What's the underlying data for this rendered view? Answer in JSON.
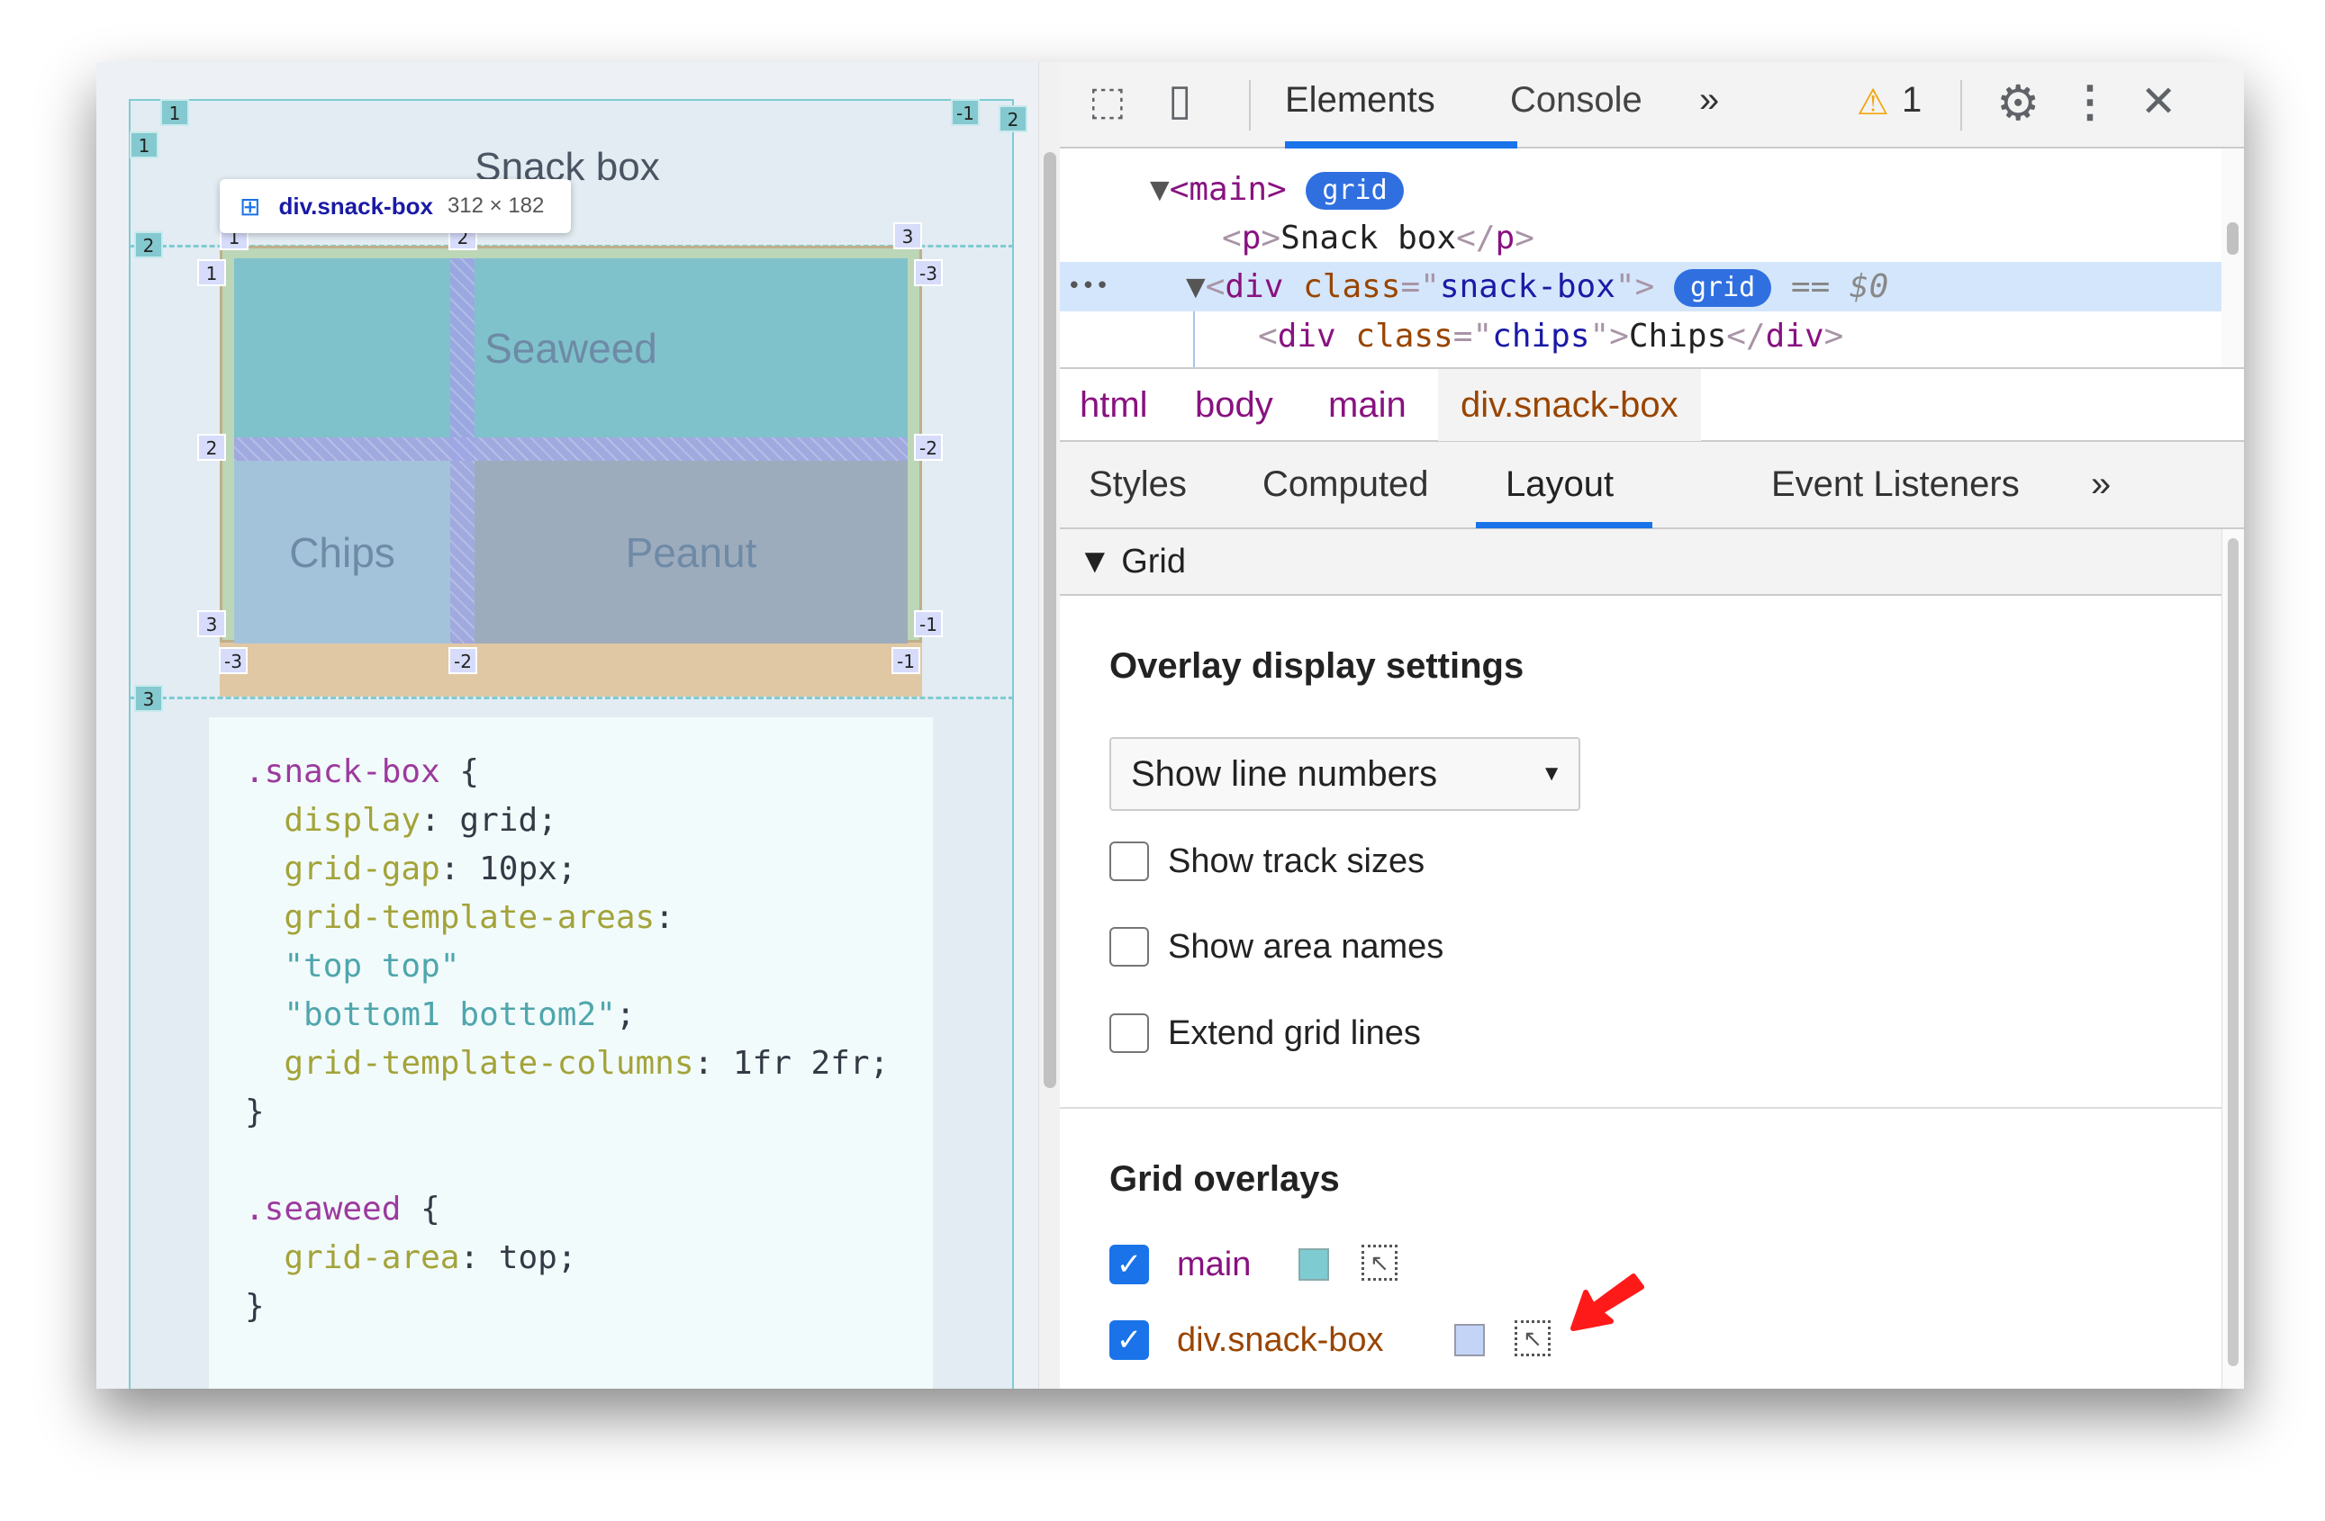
{
  "page": {
    "title": "Snack box",
    "cells": {
      "seaweed": "Seaweed",
      "chips": "Chips",
      "peanut": "Peanut"
    },
    "tooltip": {
      "selector": "div.snack-box",
      "size": "312 × 182",
      "icon": "grid-icon"
    },
    "main_badges": [
      "1",
      "1",
      "-1",
      "2",
      "2",
      "3"
    ],
    "snack_badges": [
      "1",
      "2",
      "3",
      "1",
      "-3",
      "2",
      "-2",
      "3",
      "-1",
      "-3",
      "-2",
      "-1"
    ],
    "code": [
      [
        {
          "c": "sel",
          "t": ".snack-box"
        },
        {
          "c": "",
          "t": " {"
        }
      ],
      [
        {
          "c": "",
          "t": "  "
        },
        {
          "c": "prop",
          "t": "display"
        },
        {
          "c": "",
          "t": ": grid;"
        }
      ],
      [
        {
          "c": "",
          "t": "  "
        },
        {
          "c": "prop",
          "t": "grid-gap"
        },
        {
          "c": "",
          "t": ": 10px;"
        }
      ],
      [
        {
          "c": "",
          "t": "  "
        },
        {
          "c": "prop",
          "t": "grid-template-areas"
        },
        {
          "c": "",
          "t": ":"
        }
      ],
      [
        {
          "c": "",
          "t": "  "
        },
        {
          "c": "str",
          "t": "\"top top\""
        }
      ],
      [
        {
          "c": "",
          "t": "  "
        },
        {
          "c": "str",
          "t": "\"bottom1 bottom2\""
        },
        {
          "c": "",
          "t": ";"
        }
      ],
      [
        {
          "c": "",
          "t": "  "
        },
        {
          "c": "prop",
          "t": "grid-template-columns"
        },
        {
          "c": "",
          "t": ": 1fr 2fr;"
        }
      ],
      [
        {
          "c": "",
          "t": "}"
        }
      ],
      [
        {
          "c": "",
          "t": ""
        }
      ],
      [
        {
          "c": "sel",
          "t": ".seaweed"
        },
        {
          "c": "",
          "t": " {"
        }
      ],
      [
        {
          "c": "",
          "t": "  "
        },
        {
          "c": "prop",
          "t": "grid-area"
        },
        {
          "c": "",
          "t": ": top;"
        }
      ],
      [
        {
          "c": "",
          "t": "}"
        }
      ]
    ]
  },
  "devtools": {
    "tabs": {
      "elements": "Elements",
      "console": "Console",
      "more": "»"
    },
    "warnings": {
      "icon": "warning-icon",
      "count": "1"
    },
    "dom": {
      "main_open": "<main>",
      "grid_badge": "grid",
      "p_line": "Snack box",
      "div_class": "snack-box",
      "selected_suffix": "== $0",
      "child_class": "chips",
      "child_text": "Chips",
      "dots": "•••"
    },
    "breadcrumbs": [
      "html",
      "body",
      "main",
      "div.snack-box"
    ],
    "subtabs": [
      "Styles",
      "Computed",
      "Layout",
      "Event Listeners",
      "»"
    ],
    "active_subtab": "Layout",
    "grid_section": "Grid",
    "overlay_settings": {
      "heading": "Overlay display settings",
      "select_value": "Show line numbers",
      "checkboxes": [
        {
          "label": "Show track sizes",
          "checked": false
        },
        {
          "label": "Show area names",
          "checked": false
        },
        {
          "label": "Extend grid lines",
          "checked": false
        }
      ]
    },
    "grid_overlays": {
      "heading": "Grid overlays",
      "items": [
        {
          "label": "main",
          "checked": true,
          "color": "#7fcbd2"
        },
        {
          "label": "div.snack-box",
          "checked": true,
          "color": "#c3d4f7"
        }
      ]
    }
  },
  "colors": {
    "accent": "#1a73e8",
    "annotation_arrow": "#ff1a1a"
  }
}
